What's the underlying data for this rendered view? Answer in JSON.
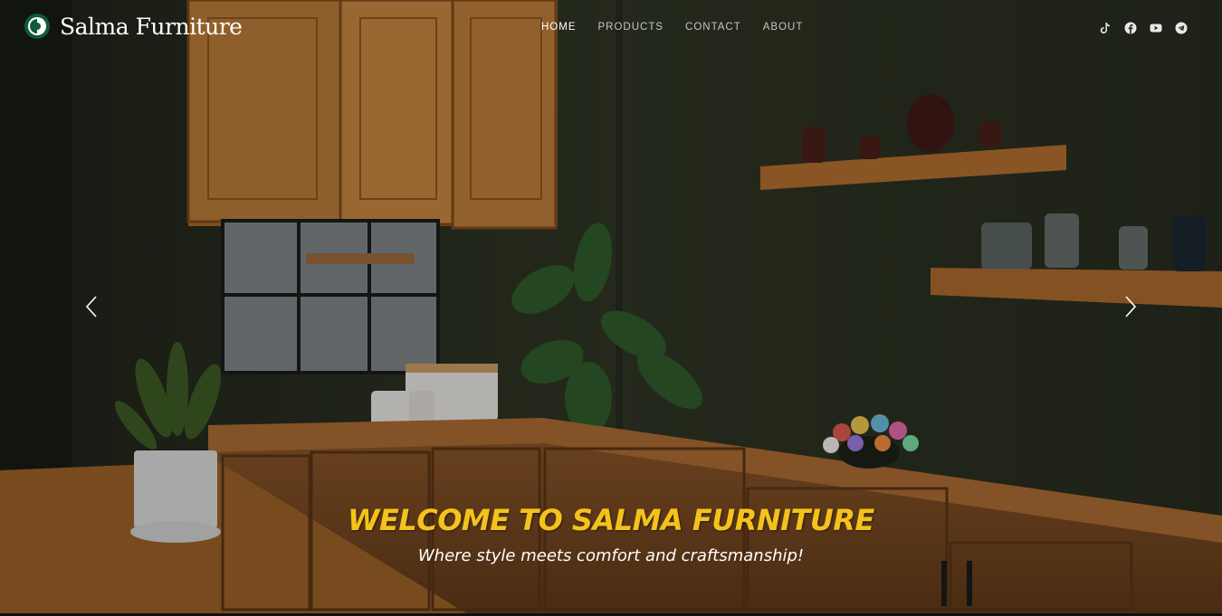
{
  "brand": {
    "name": "Salma Furniture",
    "logo_icon": "leaf-logo-icon"
  },
  "nav": {
    "items": [
      {
        "label": "HOME",
        "active": true
      },
      {
        "label": "PRODUCTS",
        "active": false
      },
      {
        "label": "CONTACT",
        "active": false
      },
      {
        "label": "ABOUT",
        "active": false
      }
    ]
  },
  "socials": [
    "tiktok-icon",
    "facebook-icon",
    "youtube-icon",
    "telegram-icon"
  ],
  "slider": {
    "prev_icon": "chevron-left-icon",
    "next_icon": "chevron-right-icon",
    "title": "WELCOME TO SALMA FURNITURE",
    "subtitle": "Where style meets comfort and craftsmanship!"
  },
  "colors": {
    "accent": "#f4c21b",
    "wall": "#2c3222",
    "wood": "#b5722e"
  }
}
